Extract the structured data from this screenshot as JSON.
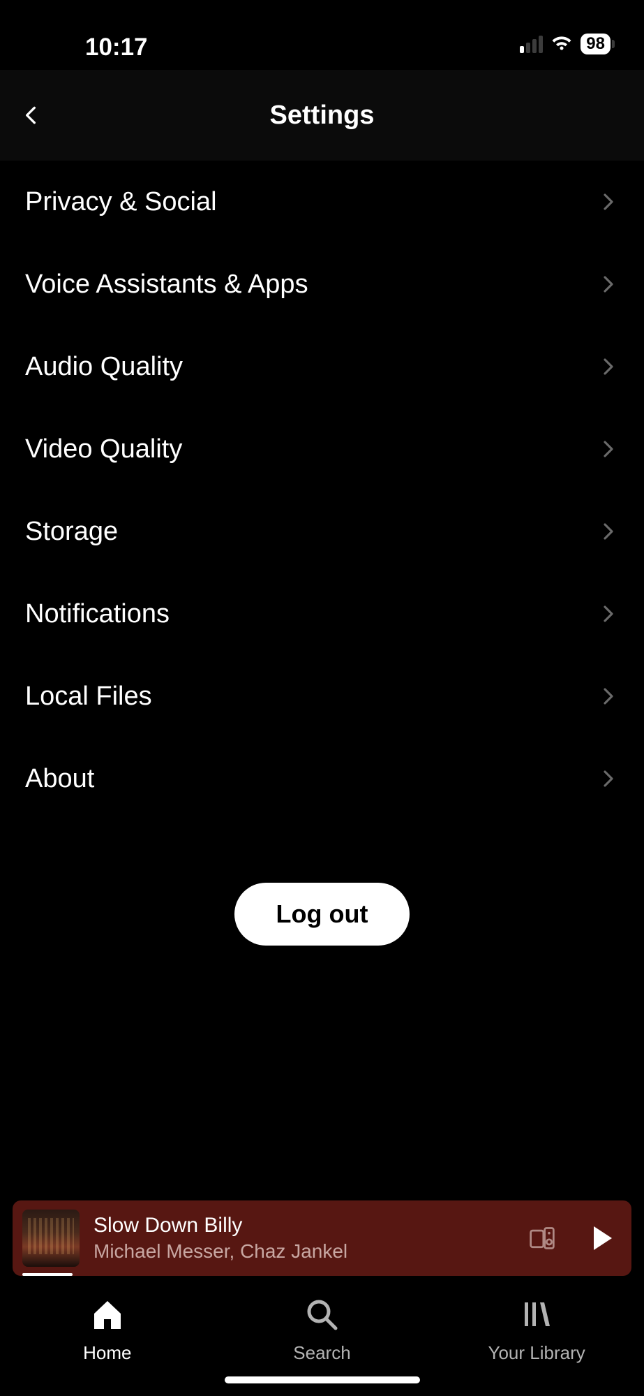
{
  "status": {
    "time": "10:17",
    "battery": "98"
  },
  "header": {
    "title": "Settings"
  },
  "settings": {
    "items": [
      {
        "label": "Privacy & Social",
        "key": "privacy-social"
      },
      {
        "label": "Voice Assistants & Apps",
        "key": "voice-assistants"
      },
      {
        "label": "Audio Quality",
        "key": "audio-quality"
      },
      {
        "label": "Video Quality",
        "key": "video-quality"
      },
      {
        "label": "Storage",
        "key": "storage"
      },
      {
        "label": "Notifications",
        "key": "notifications"
      },
      {
        "label": "Local Files",
        "key": "local-files"
      },
      {
        "label": "About",
        "key": "about"
      }
    ]
  },
  "logout": {
    "label": "Log out"
  },
  "now_playing": {
    "title": "Slow Down Billy",
    "artist": "Michael Messer, Chaz Jankel"
  },
  "nav": {
    "items": [
      {
        "label": "Home",
        "key": "home",
        "active": true
      },
      {
        "label": "Search",
        "key": "search",
        "active": false
      },
      {
        "label": "Your Library",
        "key": "library",
        "active": false
      }
    ]
  }
}
